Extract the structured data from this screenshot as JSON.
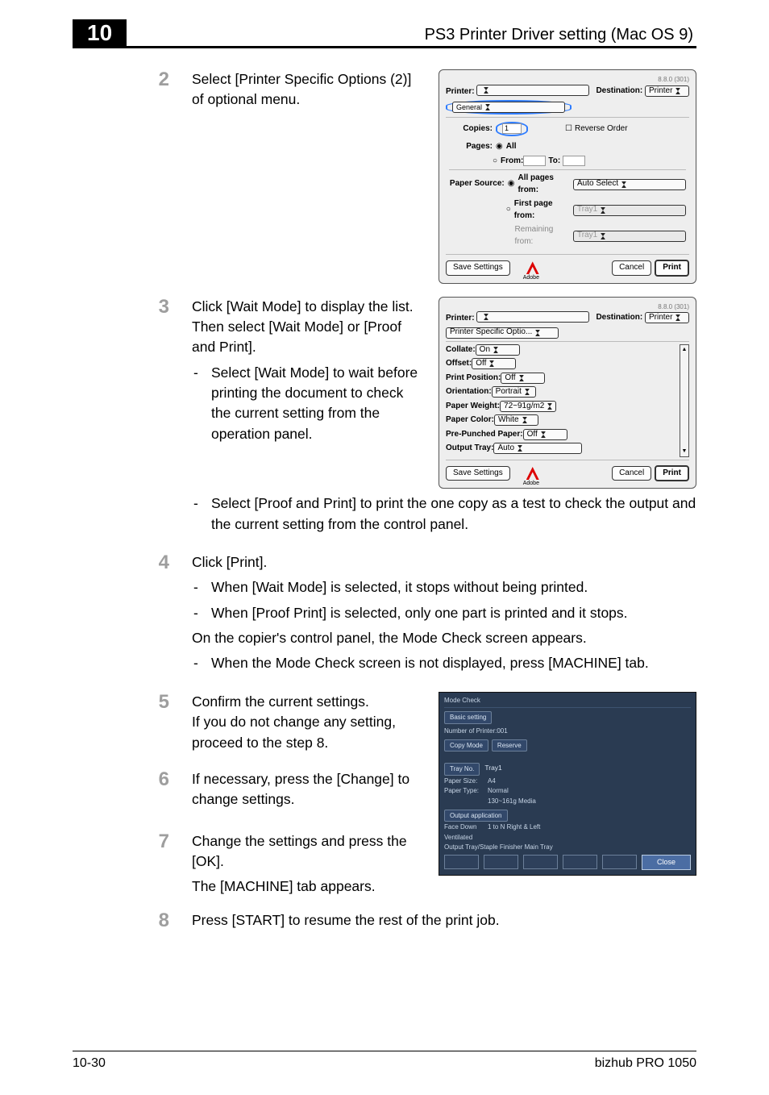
{
  "header": {
    "chapter": "10",
    "title": "PS3 Printer Driver setting (Mac OS 9)"
  },
  "steps": {
    "s2": {
      "num": "2",
      "text": "Select [Printer Specific Options (2)] of optional menu."
    },
    "s3": {
      "num": "3",
      "intro": "Click [Wait Mode] to display the list. Then select [Wait Mode] or [Proof and Print].",
      "dash1": "Select [Wait Mode] to wait before printing the document to check the current setting from the operation panel.",
      "dash2": "Select [Proof and Print] to print the one copy as a test to check the output and the current setting from the control panel."
    },
    "s4": {
      "num": "4",
      "intro": "Click [Print].",
      "dash1": "When [Wait Mode] is selected, it stops without being printed.",
      "dash2": "When [Proof Print] is selected, only one part is printed and it stops.",
      "mid": "On the copier's control panel, the Mode Check screen appears.",
      "dash3": "When the Mode Check screen is not displayed, press [MACHINE] tab."
    },
    "s5": {
      "num": "5",
      "text": "Confirm the current settings.\nIf you do not change any setting, proceed to the step 8."
    },
    "s6": {
      "num": "6",
      "text": "If necessary, press the [Change] to change settings."
    },
    "s7": {
      "num": "7",
      "text1": "Change the settings and press the [OK].",
      "text2": "The [MACHINE] tab appears."
    },
    "s8": {
      "num": "8",
      "text": "Press [START] to resume the rest of the print job."
    }
  },
  "dialog1": {
    "version": "8.8.0 (301)",
    "printer_label": "Printer:",
    "dest_label": "Destination:",
    "dest_value": "Printer",
    "tab": "General",
    "copies_label": "Copies:",
    "copies_value": "1",
    "reverse_label": "Reverse Order",
    "pages_label": "Pages:",
    "all_label": "All",
    "from_label": "From:",
    "to_label": "To:",
    "src_label": "Paper Source:",
    "all_pages_label": "All pages from:",
    "all_pages_value": "Auto Select",
    "first_page_label": "First page from:",
    "first_page_value": "Tray1",
    "remain_label": "Remaining from:",
    "remain_value": "Tray1",
    "save_btn": "Save Settings",
    "adobe_label": "Adobe",
    "cancel_btn": "Cancel",
    "print_btn": "Print"
  },
  "dialog2": {
    "version": "8.8.0 (301)",
    "printer_label": "Printer:",
    "dest_label": "Destination:",
    "dest_value": "Printer",
    "tab": "Printer Specific Optio...",
    "collate_label": "Collate:",
    "collate_value": "On",
    "offset_label": "Offset:",
    "offset_value": "Off",
    "printpos_label": "Print Position:",
    "printpos_value": "Off",
    "orient_label": "Orientation:",
    "orient_value": "Portrait",
    "pweight_label": "Paper Weight:",
    "pweight_value": "72~91g/m2",
    "pcolor_label": "Paper Color:",
    "pcolor_value": "White",
    "prepunch_label": "Pre-Punched Paper:",
    "prepunch_value": "Off",
    "outtray_label": "Output Tray:",
    "outtray_value": "Auto",
    "save_btn": "Save Settings",
    "adobe_label": "Adobe",
    "cancel_btn": "Cancel",
    "print_btn": "Print"
  },
  "machine": {
    "title": "Mode Check",
    "basic_tab": "Basic setting",
    "nprint": "Number of Printer:001",
    "copy_btn": "Copy Mode",
    "reserve_btn": "Reserve",
    "tray_btn": "Tray No.",
    "tray_val": "Tray1",
    "psize_k": "Paper Size:",
    "psize_v": "A4",
    "ptype_k": "Paper Type:",
    "ptype_v1": "Normal",
    "ptype_v2": "130~161g Media",
    "outapp_btn": "Output application",
    "face_k": "Face Down",
    "face_v": "1 to N    Right & Left",
    "ventil_k": "Ventilated",
    "out_k": "Output Tray/Staple Finisher Main Tray",
    "close_btn": "Close"
  },
  "footer": {
    "left": "10-30",
    "right": "bizhub PRO 1050"
  }
}
